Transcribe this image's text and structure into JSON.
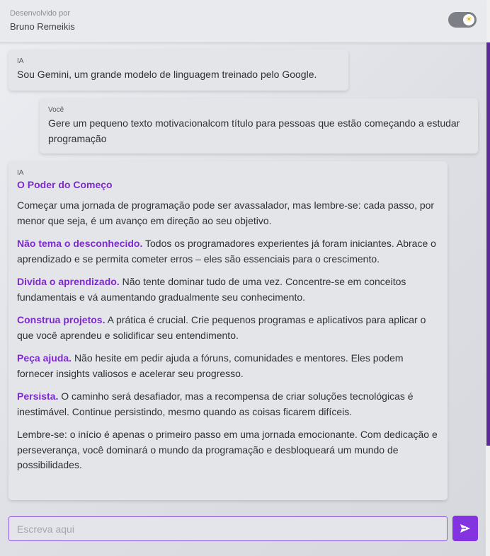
{
  "header": {
    "developed_by_label": "Desenvolvido por",
    "developer_name": "Bruno Remeikis",
    "theme_toggle_icon": "sun-icon"
  },
  "messages": [
    {
      "sender": "IA",
      "text": "Sou Gemini, um grande modelo de linguagem treinado pelo Google."
    },
    {
      "sender": "Você",
      "text": "Gere um pequeno texto motivacionalcom título para pessoas que estão começando a estudar programação"
    },
    {
      "sender": "IA",
      "title": "O Poder do Começo",
      "intro": "Começar uma jornada de programação pode ser avassalador, mas lembre-se: cada passo, por menor que seja, é um avanço em direção ao seu objetivo.",
      "tips": [
        {
          "heading": "Não tema o desconhecido.",
          "body": "Todos os programadores experientes já foram iniciantes. Abrace o aprendizado e se permita cometer erros – eles são essenciais para o crescimento."
        },
        {
          "heading": "Divida o aprendizado.",
          "body": "Não tente dominar tudo de uma vez. Concentre-se em conceitos fundamentais e vá aumentando gradualmente seu conhecimento."
        },
        {
          "heading": "Construa projetos.",
          "body": "A prática é crucial. Crie pequenos programas e aplicativos para aplicar o que você aprendeu e solidificar seu entendimento."
        },
        {
          "heading": "Peça ajuda.",
          "body": "Não hesite em pedir ajuda a fóruns, comunidades e mentores. Eles podem fornecer insights valiosos e acelerar seu progresso."
        },
        {
          "heading": "Persista.",
          "body": "O caminho será desafiador, mas a recompensa de criar soluções tecnológicas é inestimável. Continue persistindo, mesmo quando as coisas ficarem difíceis."
        }
      ],
      "closing": "Lembre-se: o início é apenas o primeiro passo em uma jornada emocionante. Com dedicação e perseverança, você dominará o mundo da programação e desbloqueará um mundo de possibilidades."
    }
  ],
  "composer": {
    "placeholder": "Escreva aqui",
    "value": "",
    "send_icon": "send-icon"
  },
  "colors": {
    "accent": "#7d2ad0",
    "send_button": "#8433e0",
    "scrollbar": "#5b2a96"
  }
}
